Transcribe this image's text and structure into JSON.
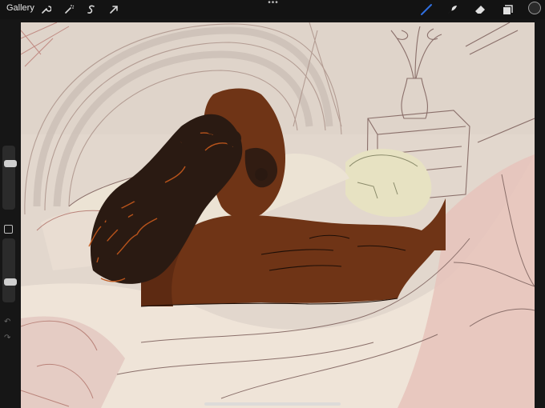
{
  "app": {
    "gallery_label": "Gallery"
  },
  "toolbar": {
    "left_icons": [
      "wrench-icon",
      "magic-wand-icon",
      "selection-icon",
      "transform-arrow-icon"
    ],
    "more_label": "•••",
    "right_icons": [
      "brush-icon",
      "smudge-icon",
      "eraser-icon",
      "layers-icon"
    ],
    "active_tool": "brush",
    "active_color": "#2a2a2a",
    "brush_accent": "#2f6fe0"
  },
  "sidebar": {
    "size_slider_level": 0.75,
    "opacity_slider_level": 0.3
  },
  "canvas": {
    "background": "#e2d7cd",
    "skin_color": "#6f3416",
    "hair_color": "#2a1a12",
    "hair_highlight": "#c0571c",
    "sheet_color": "#efe4d8",
    "sheet_pink": "#e6c3bb",
    "sketch_color": "#8a6f6a",
    "pillow_color": "#e7e2c2"
  }
}
